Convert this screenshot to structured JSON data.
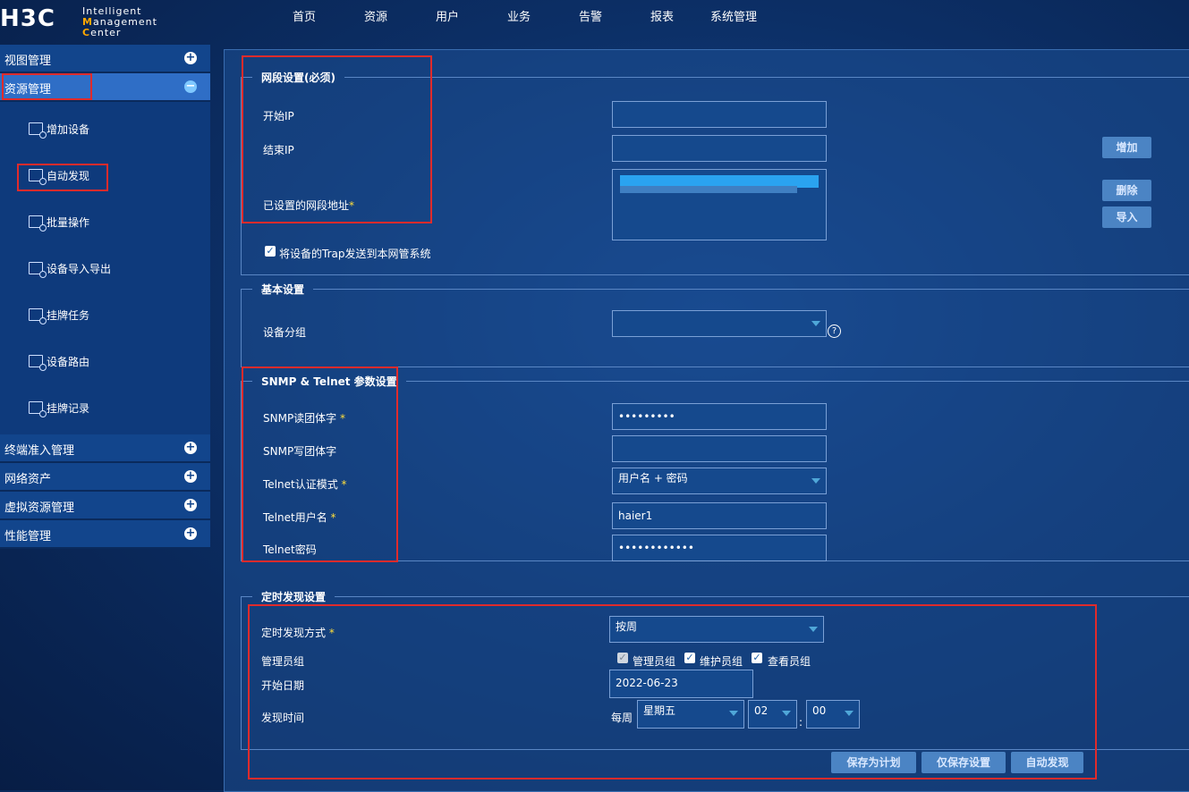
{
  "logo": {
    "mark": "H3C",
    "line1": "Intelligent",
    "line2_hl1": "M",
    "line2_a": "anagement ",
    "line2_hl2": "C",
    "line2_b": "enter"
  },
  "nav": [
    "首页",
    "资源",
    "用户",
    "业务",
    "告警",
    "报表",
    "系统管理"
  ],
  "sidebar": {
    "groups_top": [
      {
        "label": "视图管理",
        "state": "+"
      },
      {
        "label": "资源管理",
        "state": "−"
      }
    ],
    "items": [
      "增加设备",
      "自动发现",
      "批量操作",
      "设备导入导出",
      "挂牌任务",
      "设备路由",
      "挂牌记录"
    ],
    "groups_bottom": [
      {
        "label": "终端准入管理",
        "state": "+"
      },
      {
        "label": "网络资产",
        "state": "+"
      },
      {
        "label": "虚拟资源管理",
        "state": "+"
      },
      {
        "label": "性能管理",
        "state": "+"
      }
    ]
  },
  "segment": {
    "legend": "网段设置(必须)",
    "start_ip_label": "开始IP",
    "end_ip_label": "结束IP",
    "configured_label": "已设置的网段地址",
    "start_ip_value": "",
    "end_ip_value": "",
    "add_button": "增加",
    "delete_button": "删除",
    "import_button": "导入",
    "trap_label": "将设备的Trap发送到本网管系统"
  },
  "basic": {
    "legend": "基本设置",
    "group_label": "设备分组",
    "group_value": "",
    "help": "?"
  },
  "snmp": {
    "legend": "SNMP & Telnet 参数设置",
    "read_label": "SNMP读团体字",
    "read_value": "•••••••••",
    "write_label": "SNMP写团体字",
    "write_value": "",
    "auth_label": "Telnet认证模式",
    "auth_value": "用户名 + 密码",
    "user_label": "Telnet用户名",
    "user_value": "haier1",
    "pass_label": "Telnet密码",
    "pass_value": "••••••••••••"
  },
  "schedule": {
    "legend": "定时发现设置",
    "mode_label": "定时发现方式",
    "mode_value": "按周",
    "admin_label": "管理员组",
    "groups": [
      "管理员组",
      "维护员组",
      "查看员组"
    ],
    "start_label": "开始日期",
    "start_value": "2022-06-23",
    "time_label": "发现时间",
    "every_week": "每周",
    "weekday": "星期五",
    "hour": "02",
    "colon": ":",
    "minute": "00",
    "required_mark": "*"
  },
  "footer": {
    "save_plan": "保存为计划",
    "save_only": "仅保存设置",
    "auto_discover": "自动发现"
  },
  "colors": {
    "highlight_box": "#e02b2b",
    "accent": "#ffa800"
  }
}
